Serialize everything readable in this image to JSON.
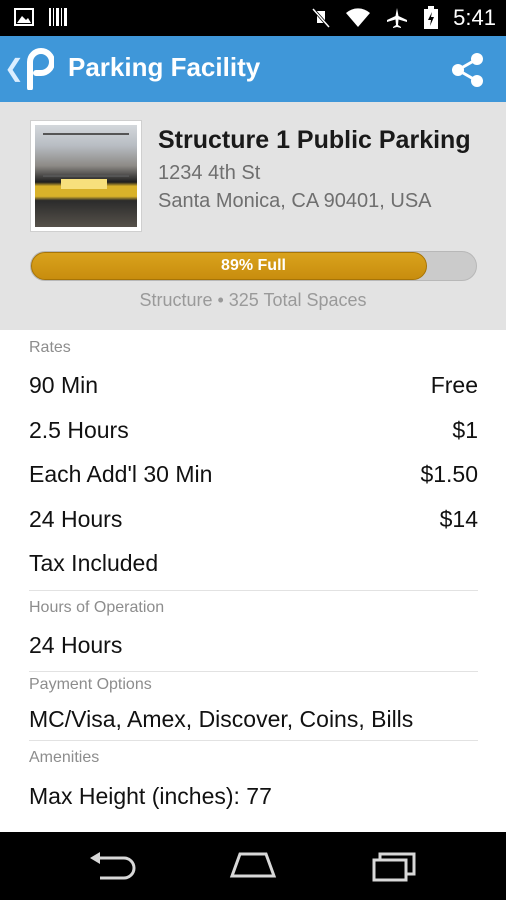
{
  "status_bar": {
    "time": "5:41",
    "icons": [
      "image-icon",
      "barcode-icon",
      "mute-icon",
      "wifi-icon",
      "airplane-icon",
      "battery-charging-icon"
    ]
  },
  "app_bar": {
    "title": "Parking Facility",
    "back_icon": "chevron-left-icon",
    "logo_icon": "parkme-logo-icon",
    "share_icon": "share-icon",
    "color": "#3f97d9"
  },
  "facility": {
    "name": "Structure 1 Public Parking",
    "address_line1": "1234 4th St",
    "address_line2": "Santa Monica, CA 90401, USA",
    "occupancy_percent": 89,
    "occupancy_label": "89% Full",
    "meta": "Structure • 325 Total Spaces",
    "bar_color": "#c88d0e"
  },
  "sections": {
    "rates_label": "Rates",
    "rates": [
      {
        "label": "90 Min",
        "value": "Free"
      },
      {
        "label": "2.5 Hours",
        "value": "$1"
      },
      {
        "label": "Each Add'l 30 Min",
        "value": "$1.50"
      },
      {
        "label": "24 Hours",
        "value": "$14"
      },
      {
        "label": "Tax Included",
        "value": ""
      }
    ],
    "hours_label": "Hours of Operation",
    "hours_value": "24 Hours",
    "payment_label": "Payment Options",
    "payment_value": "MC/Visa, Amex, Discover, Coins, Bills",
    "amenities_label": "Amenities",
    "amenities_value": "Max Height (inches): 77"
  },
  "nav_bar": {
    "icons": [
      "back-icon",
      "home-icon",
      "recents-icon"
    ]
  }
}
